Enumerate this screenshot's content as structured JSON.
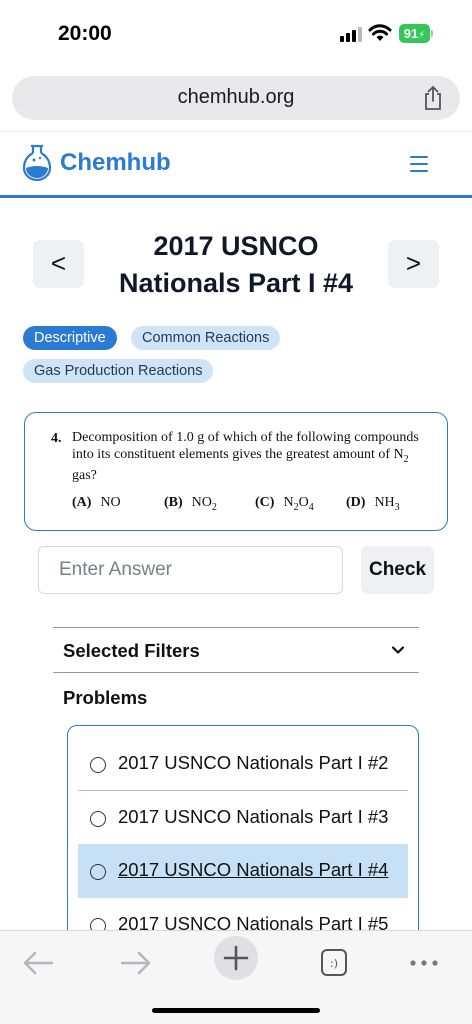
{
  "status": {
    "time": "20:00",
    "battery": "91"
  },
  "browser": {
    "url": "chemhub.org"
  },
  "site": {
    "brand": "Chemhub"
  },
  "page": {
    "title": "2017 USNCO Nationals Part I #4",
    "prev": "<",
    "next": ">"
  },
  "tags": [
    "Descriptive",
    "Common Reactions",
    "Gas Production Reactions"
  ],
  "problem": {
    "number": "4.",
    "text_before": "Decomposition of 1.0 g of which of the following compounds into its constituent elements gives the greatest amount of N",
    "text_sub": "2",
    "text_after": " gas?",
    "choices": [
      {
        "letter": "(A)",
        "main": "NO",
        "sub": "",
        "tail": ""
      },
      {
        "letter": "(B)",
        "main": "NO",
        "sub": "2",
        "tail": ""
      },
      {
        "letter": "(C)",
        "main": "N",
        "sub": "2",
        "tail": "O",
        "sub2": "4"
      },
      {
        "letter": "(D)",
        "main": "NH",
        "sub": "3",
        "tail": ""
      }
    ]
  },
  "answer": {
    "placeholder": "Enter Answer",
    "value": "",
    "check_label": "Check"
  },
  "filters": {
    "label": "Selected Filters"
  },
  "problems": {
    "label": "Problems",
    "items": [
      {
        "label": "2017 USNCO Nationals Part I #2",
        "selected": false
      },
      {
        "label": "2017 USNCO Nationals Part I #3",
        "selected": false
      },
      {
        "label": "2017 USNCO Nationals Part I #4",
        "selected": true
      },
      {
        "label": "2017 USNCO Nationals Part I #5",
        "selected": false
      }
    ]
  },
  "colors": {
    "accent": "#2b7bd4",
    "tag_light": "#cfe5f7",
    "selected_row": "#c6e1f5"
  }
}
